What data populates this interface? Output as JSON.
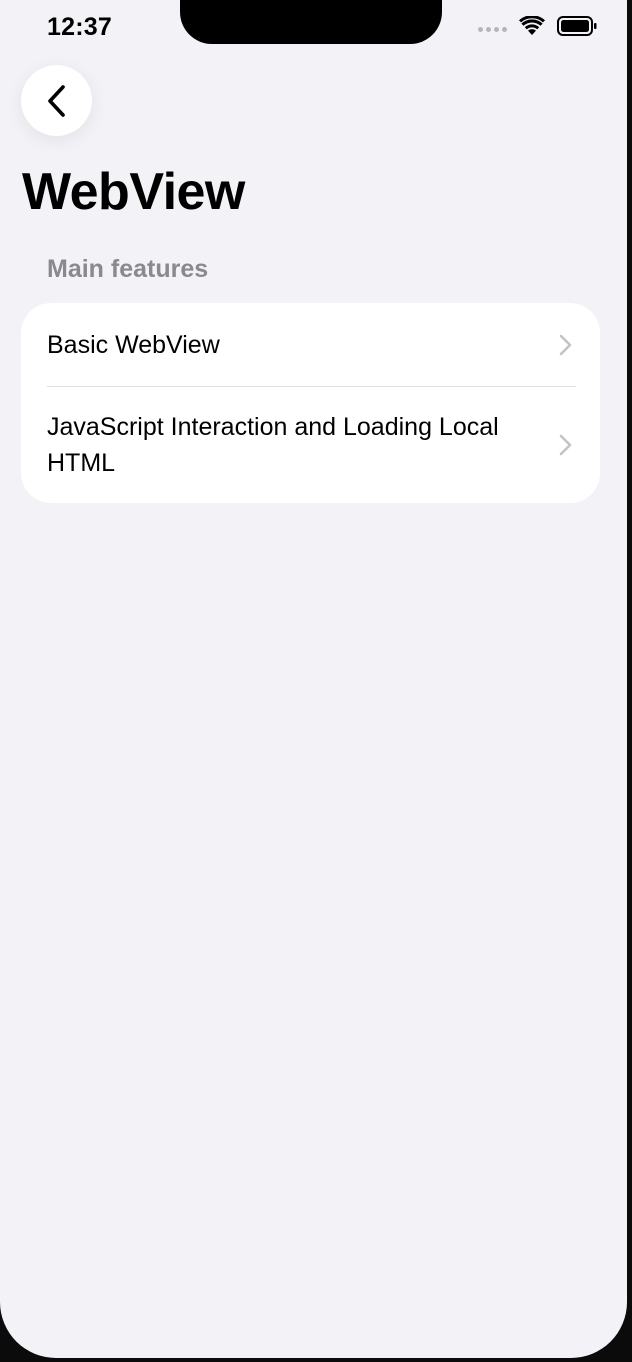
{
  "status_bar": {
    "time": "12:37"
  },
  "nav": {
    "back_icon": "chevron-left-icon"
  },
  "page": {
    "title": "WebView"
  },
  "section": {
    "header": "Main features",
    "items": [
      {
        "label": "Basic WebView",
        "icon": "chevron-right-icon"
      },
      {
        "label": "JavaScript Interaction and Loading Local HTML",
        "icon": "chevron-right-icon"
      }
    ]
  },
  "colors": {
    "background": "#f2f2f7",
    "card": "#ffffff",
    "secondary_text": "#8a8a8e",
    "chevron": "#c4c4c7"
  }
}
